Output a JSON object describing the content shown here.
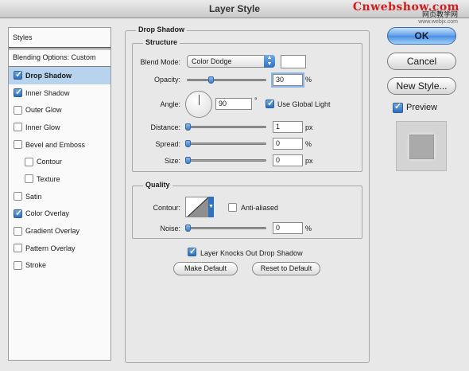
{
  "window": {
    "title": "Layer Style"
  },
  "watermark": {
    "brand": "Cnwebshow.com",
    "line2": "网页教学网",
    "url": "www.webjx.com"
  },
  "sidebar": {
    "header": "Styles",
    "blending": "Blending Options: Custom",
    "items": [
      {
        "label": "Drop Shadow",
        "checked": true,
        "selected": true,
        "indent": false
      },
      {
        "label": "Inner Shadow",
        "checked": true,
        "selected": false,
        "indent": false
      },
      {
        "label": "Outer Glow",
        "checked": false,
        "selected": false,
        "indent": false
      },
      {
        "label": "Inner Glow",
        "checked": false,
        "selected": false,
        "indent": false
      },
      {
        "label": "Bevel and Emboss",
        "checked": false,
        "selected": false,
        "indent": false
      },
      {
        "label": "Contour",
        "checked": false,
        "selected": false,
        "indent": true
      },
      {
        "label": "Texture",
        "checked": false,
        "selected": false,
        "indent": true
      },
      {
        "label": "Satin",
        "checked": false,
        "selected": false,
        "indent": false
      },
      {
        "label": "Color Overlay",
        "checked": true,
        "selected": false,
        "indent": false
      },
      {
        "label": "Gradient Overlay",
        "checked": false,
        "selected": false,
        "indent": false
      },
      {
        "label": "Pattern Overlay",
        "checked": false,
        "selected": false,
        "indent": false
      },
      {
        "label": "Stroke",
        "checked": false,
        "selected": false,
        "indent": false
      }
    ]
  },
  "drop_shadow": {
    "title": "Drop Shadow",
    "structure": {
      "title": "Structure",
      "blend_mode_label": "Blend Mode:",
      "blend_mode_value": "Color Dodge",
      "blend_color": "#ffffff",
      "opacity_label": "Opacity:",
      "opacity_value": "30",
      "opacity_fraction": 0.3,
      "opacity_unit": "%",
      "angle_label": "Angle:",
      "angle_value": "90",
      "angle_unit": "°",
      "global_light_label": "Use Global Light",
      "global_light_checked": true,
      "distance_label": "Distance:",
      "distance_value": "1",
      "distance_fraction": 0.0,
      "distance_unit": "px",
      "spread_label": "Spread:",
      "spread_value": "0",
      "spread_fraction": 0.0,
      "spread_unit": "%",
      "size_label": "Size:",
      "size_value": "0",
      "size_fraction": 0.0,
      "size_unit": "px"
    },
    "quality": {
      "title": "Quality",
      "contour_label": "Contour:",
      "anti_aliased_label": "Anti-aliased",
      "anti_aliased_checked": false,
      "noise_label": "Noise:",
      "noise_value": "0",
      "noise_fraction": 0.0,
      "noise_unit": "%"
    },
    "knockout_label": "Layer Knocks Out Drop Shadow",
    "knockout_checked": true,
    "make_default_label": "Make Default",
    "reset_default_label": "Reset to Default"
  },
  "actions": {
    "ok_label": "OK",
    "cancel_label": "Cancel",
    "new_style_label": "New Style...",
    "preview_label": "Preview",
    "preview_checked": true
  }
}
